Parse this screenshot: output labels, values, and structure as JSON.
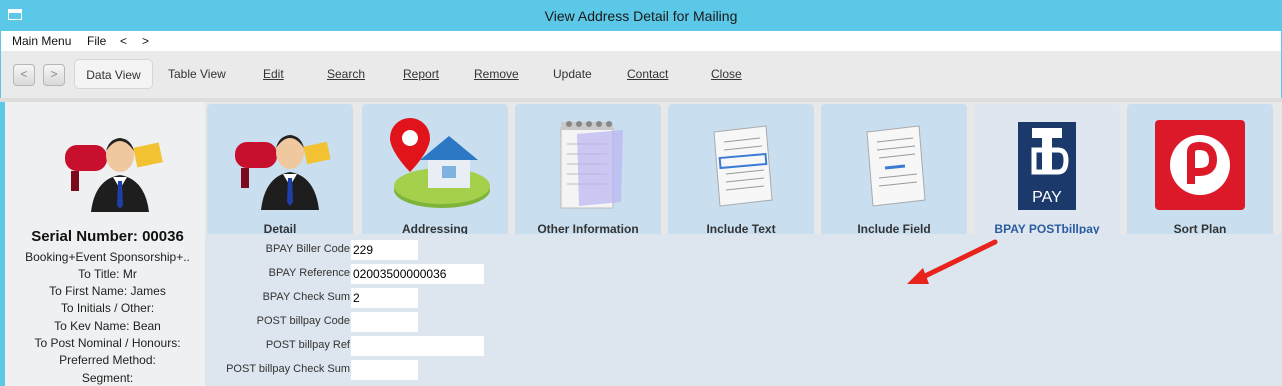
{
  "window": {
    "title": "View Address Detail for Mailing"
  },
  "menu": {
    "main_menu": "Main Menu",
    "file": "File",
    "back": "<",
    "forward": ">"
  },
  "toolbar": {
    "back": "<",
    "forward": ">",
    "data_view": "Data View",
    "table_view": "Table View",
    "edit": "Edit",
    "search": "Search",
    "report": "Report",
    "remove": "Remove",
    "update": "Update",
    "contact": "Contact",
    "close": "Close"
  },
  "left": {
    "serial": "Serial Number: 00036",
    "lines": [
      "Booking+Event Sponsorship+..",
      "To Title: Mr",
      "To First Name: James",
      "To Initials / Other:",
      "To Kev Name: Bean",
      "To Post Nominal / Honours:",
      "Preferred Method:",
      "Segment:"
    ]
  },
  "tabs": [
    {
      "label": "Detail",
      "icon": "mailbox-person-icon"
    },
    {
      "label": "Addressing",
      "icon": "map-pin-house-icon"
    },
    {
      "label": "Other Information",
      "icon": "notepad-icon"
    },
    {
      "label": "Include Text",
      "icon": "document-text-icon"
    },
    {
      "label": "Include Field",
      "icon": "document-field-icon"
    },
    {
      "label": "BPAY POSTbillpay",
      "icon": "bpay-logo-icon",
      "active": true
    },
    {
      "label": "Sort Plan",
      "icon": "auspost-logo-icon"
    }
  ],
  "fields": {
    "biller_code": {
      "label": "BPAY Biller Code",
      "value": "229"
    },
    "reference": {
      "label": "BPAY Reference",
      "value": "02003500000036"
    },
    "check_sum": {
      "label": "BPAY Check Sum",
      "value": "2"
    },
    "post_code": {
      "label": "POST billpay Code",
      "value": ""
    },
    "post_ref": {
      "label": "POST billpay Ref",
      "value": ""
    },
    "post_check": {
      "label": "POST billpay Check Sum",
      "value": ""
    }
  },
  "colors": {
    "titlebar": "#5bc8e8",
    "tab": "#c9dff0",
    "content": "#dde5ee",
    "arrow": "#e8231c"
  }
}
